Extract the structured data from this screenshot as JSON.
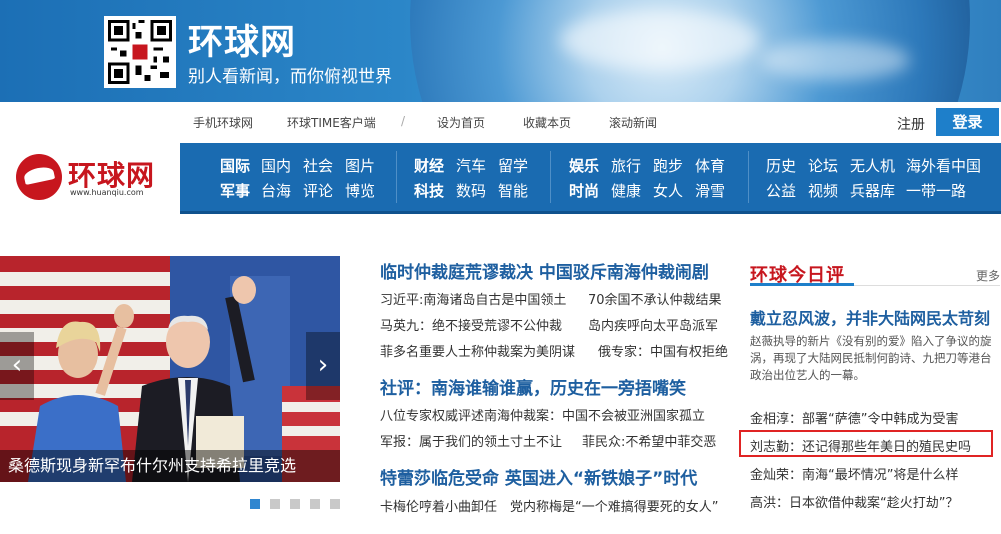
{
  "banner": {
    "title": "环球网",
    "slogan": "别人看新闻，而你俯视世界",
    "qr_icon": "qr-code-icon"
  },
  "toplinks": [
    "手机环球网",
    "环球TIME客户端",
    "/",
    "设为首页",
    "收藏本页",
    "滚动新闻"
  ],
  "auth": {
    "register": "注册",
    "login": "登录"
  },
  "logo": {
    "name": "环球网",
    "url": "www.huanqiu.com"
  },
  "nav": {
    "row1": [
      "国际",
      "国内",
      "社会",
      "图片",
      "财经",
      "汽车",
      "留学",
      "娱乐",
      "旅行",
      "跑步",
      "体育",
      "历史",
      "论坛",
      "无人机",
      "海外看中国"
    ],
    "row2": [
      "军事",
      "台海",
      "评论",
      "博览",
      "科技",
      "数码",
      "智能",
      "时尚",
      "健康",
      "女人",
      "滑雪",
      "公益",
      "视频",
      "兵器库",
      "一带一路"
    ]
  },
  "slider": {
    "caption": "桑德斯现身新罕布什尔州支持希拉里竞选",
    "prev_icon": "chevron-left-icon",
    "next_icon": "chevron-right-icon",
    "dot_count": 5,
    "active_dot": 0
  },
  "headlines": {
    "h1": "临时仲裁庭荒谬裁决 中国驳斥南海仲裁闹剧",
    "h1_links": [
      [
        "习近平:南海诸岛自古是中国领土",
        "70余国不承认仲裁结果"
      ],
      [
        "马英九：绝不接受荒谬不公仲裁",
        "岛内疾呼向太平岛派军"
      ],
      [
        "菲多名重要人士称仲裁案为美阴谋",
        "俄专家：中国有权拒绝"
      ]
    ],
    "h2": "社评：南海谁输谁赢，历史在一旁捂嘴笑",
    "h2_links": [
      [
        "八位专家权威评述南海仲裁案：中国不会被亚洲国家孤立"
      ],
      [
        "军报：属于我们的领土寸土不让",
        "菲民众:不希望中菲交恶"
      ]
    ],
    "h3": "特蕾莎临危受命 英国进入“新铁娘子”时代",
    "h3_links": [
      [
        "卡梅伦哼着小曲卸任",
        "党内称梅是“一个难搞得要死的女人”"
      ]
    ]
  },
  "today": {
    "title": "环球今日评",
    "more": "更多",
    "feature_title": "戴立忍风波，并非大陆网民太苛刻",
    "feature_summary": "赵薇执导的新片《没有别的爱》陷入了争议的旋涡，再现了大陆网民抵制何韵诗、九把刀等港台政治出位艺人的一幕。",
    "links": [
      "金相淳：部署“萨德”令中韩成为受害",
      "刘志勤：还记得那些年美日的殖民史吗",
      "金灿荣：南海“最坏情况”将是什么样",
      "高洪：日本欲借仲裁案“趁火打劫”？"
    ],
    "highlighted_index": 1,
    "highlight_color": "#e02424"
  },
  "colors": {
    "brand_red": "#c7161e",
    "nav_blue": "#1a6bb1",
    "headline_blue": "#1e5fa0",
    "login_blue": "#1e7fca"
  }
}
